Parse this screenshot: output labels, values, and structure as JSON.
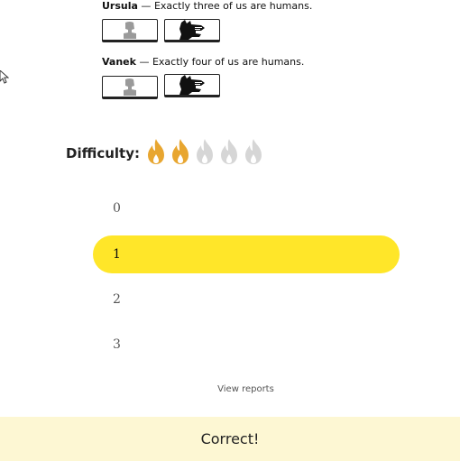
{
  "puzzle": {
    "statements": [
      {
        "speaker": "Ursula",
        "dash": " — ",
        "text": "Exactly three of us are humans."
      },
      {
        "speaker": "Vanek",
        "dash": " — ",
        "text": "Exactly four of us are humans."
      }
    ],
    "choice_icons": [
      "human-icon",
      "werewolf-icon"
    ]
  },
  "difficulty": {
    "label": "Difficulty:",
    "level": 2,
    "max": 5,
    "active_color": "#e8a630",
    "inactive_color": "#d6d6d6"
  },
  "answers": {
    "options": [
      "0",
      "1",
      "2",
      "3"
    ],
    "selected_index": 1,
    "highlight_color": "#ffe629"
  },
  "links": {
    "view_reports": "View reports"
  },
  "result": {
    "message": "Correct!",
    "background": "#fdf7d3"
  }
}
